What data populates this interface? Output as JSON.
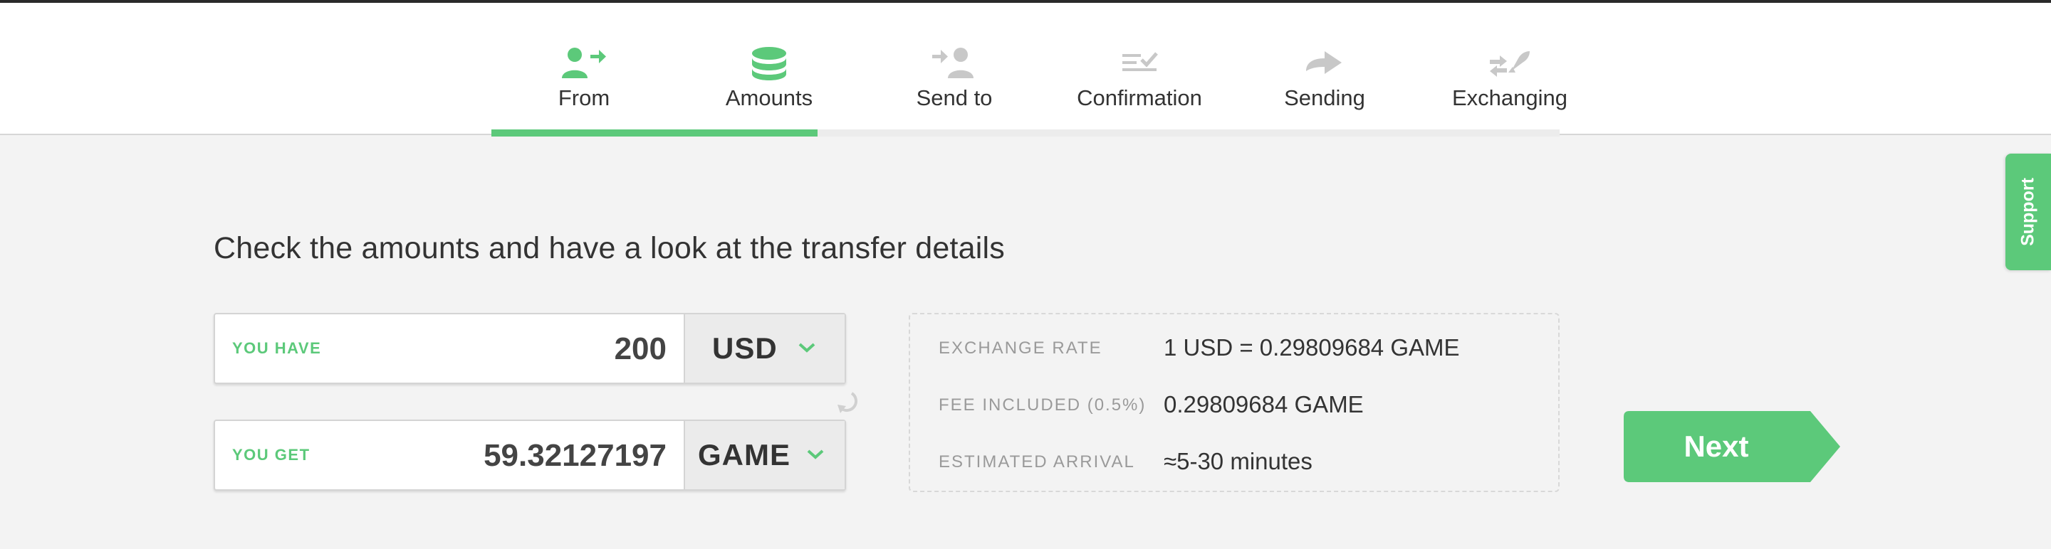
{
  "steps": [
    {
      "label": "From",
      "icon": "user-transfer-icon",
      "status": "done"
    },
    {
      "label": "Amounts",
      "icon": "coins-stack-icon",
      "status": "current"
    },
    {
      "label": "Send to",
      "icon": "send-to-user-icon",
      "status": "upcoming"
    },
    {
      "label": "Confirmation",
      "icon": "checklist-icon",
      "status": "upcoming"
    },
    {
      "label": "Sending",
      "icon": "arrow-forward-icon",
      "status": "upcoming"
    },
    {
      "label": "Exchanging",
      "icon": "rocket-exchange-icon",
      "status": "upcoming"
    }
  ],
  "progress": {
    "completed_steps": 2,
    "total_steps": 6
  },
  "main": {
    "heading": "Check the amounts and have a look at the transfer details"
  },
  "you_have": {
    "label": "YOU HAVE",
    "value": "200",
    "currency": "USD"
  },
  "you_get": {
    "label": "YOU GET",
    "value": "59.32127197",
    "currency": "GAME"
  },
  "details": [
    {
      "label": "EXCHANGE RATE",
      "value": "1 USD = 0.29809684 GAME"
    },
    {
      "label": "FEE INCLUDED (0.5%)",
      "value": "0.29809684 GAME"
    },
    {
      "label": "ESTIMATED ARRIVAL",
      "value": "≈5-30 minutes"
    }
  ],
  "next_button": {
    "label": "Next"
  },
  "support_tab": {
    "label": "Support"
  },
  "colors": {
    "accent": "#5cc97a",
    "inactive_icon": "#c8c8c8",
    "background": "#f3f3f3",
    "topbar": "#ffffff",
    "text": "#333333",
    "muted_label": "#9a9a9a"
  }
}
